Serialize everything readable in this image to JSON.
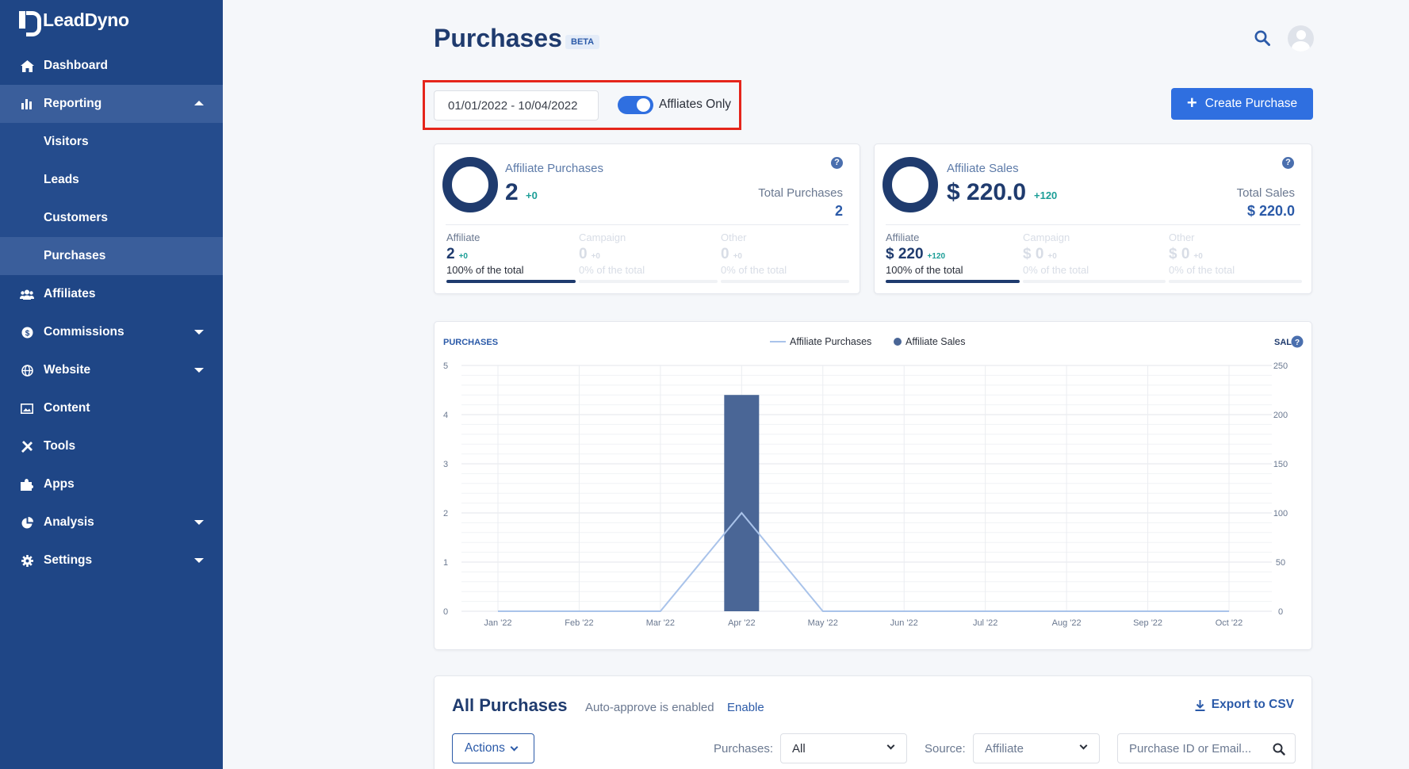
{
  "app": {
    "name": "LeadDyno"
  },
  "sidebar": {
    "items": [
      {
        "label": "Dashboard"
      },
      {
        "label": "Reporting"
      },
      {
        "label": "Visitors"
      },
      {
        "label": "Leads"
      },
      {
        "label": "Customers"
      },
      {
        "label": "Purchases"
      },
      {
        "label": "Affiliates"
      },
      {
        "label": "Commissions"
      },
      {
        "label": "Website"
      },
      {
        "label": "Content"
      },
      {
        "label": "Tools"
      },
      {
        "label": "Apps"
      },
      {
        "label": "Analysis"
      },
      {
        "label": "Settings"
      }
    ]
  },
  "header": {
    "title": "Purchases",
    "badge": "BETA"
  },
  "controls": {
    "date_range": "01/01/2022 - 10/04/2022",
    "toggle_label": "Affliates Only",
    "create_button": "Create Purchase"
  },
  "cards": {
    "purchases": {
      "label": "Affiliate Purchases",
      "value": "2",
      "delta": "+0",
      "total_label": "Total Purchases",
      "total_value": "2",
      "breakdown": [
        {
          "label": "Affiliate",
          "value": "2",
          "delta": "+0",
          "pct": "100% of the total",
          "share": 1
        },
        {
          "label": "Campaign",
          "value": "0",
          "delta": "+0",
          "pct": "0% of the total",
          "share": 0
        },
        {
          "label": "Other",
          "value": "0",
          "delta": "+0",
          "pct": "0% of the total",
          "share": 0
        }
      ]
    },
    "sales": {
      "label": "Affiliate Sales",
      "value": "$ 220.0",
      "delta": "+120",
      "total_label": "Total Sales",
      "total_value": "$ 220.0",
      "breakdown": [
        {
          "label": "Affiliate",
          "value": "$ 220",
          "delta": "+120",
          "pct": "100% of the total",
          "share": 1
        },
        {
          "label": "Campaign",
          "value": "$ 0",
          "delta": "+0",
          "pct": "0% of the total",
          "share": 0
        },
        {
          "label": "Other",
          "value": "$ 0",
          "delta": "+0",
          "pct": "0% of the total",
          "share": 0
        }
      ]
    }
  },
  "chart_data": {
    "type": "bar",
    "left_axis_label": "PURCHASES",
    "right_axis_label": "SALE",
    "categories": [
      "Jan '22",
      "Feb '22",
      "Mar '22",
      "Apr '22",
      "May '22",
      "Jun '22",
      "Jul '22",
      "Aug '22",
      "Sep '22",
      "Oct '22"
    ],
    "series": [
      {
        "name": "Affiliate Purchases",
        "type": "line",
        "axis": "left",
        "color": "#a9c3ea",
        "values": [
          0,
          0,
          0,
          2,
          0,
          0,
          0,
          0,
          0,
          0
        ]
      },
      {
        "name": "Affiliate Sales",
        "type": "bar",
        "axis": "right",
        "color": "#4a6696",
        "values": [
          0,
          0,
          0,
          220,
          0,
          0,
          0,
          0,
          0,
          0
        ]
      }
    ],
    "y_left": {
      "min": 0,
      "max": 5,
      "ticks": [
        "0",
        "1",
        "2",
        "3",
        "4",
        "5"
      ]
    },
    "y_right": {
      "min": 0,
      "max": 250,
      "ticks": [
        "0",
        "50",
        "100",
        "150",
        "200",
        "250"
      ]
    },
    "legend_position": "top-center",
    "grid": true
  },
  "list": {
    "title": "All Purchases",
    "auto_approve": "Auto-approve is enabled",
    "enable": "Enable",
    "export": "Export to CSV",
    "actions": "Actions",
    "purchases_label": "Purchases:",
    "purchases_value": "All",
    "source_label": "Source:",
    "source_value": "Affiliate",
    "search_placeholder": "Purchase ID or Email..."
  },
  "colors": {
    "sidebar": "#1f4686",
    "accent": "#2f6fe0",
    "highlight": "#e5251b",
    "positive": "#1c9e97"
  }
}
